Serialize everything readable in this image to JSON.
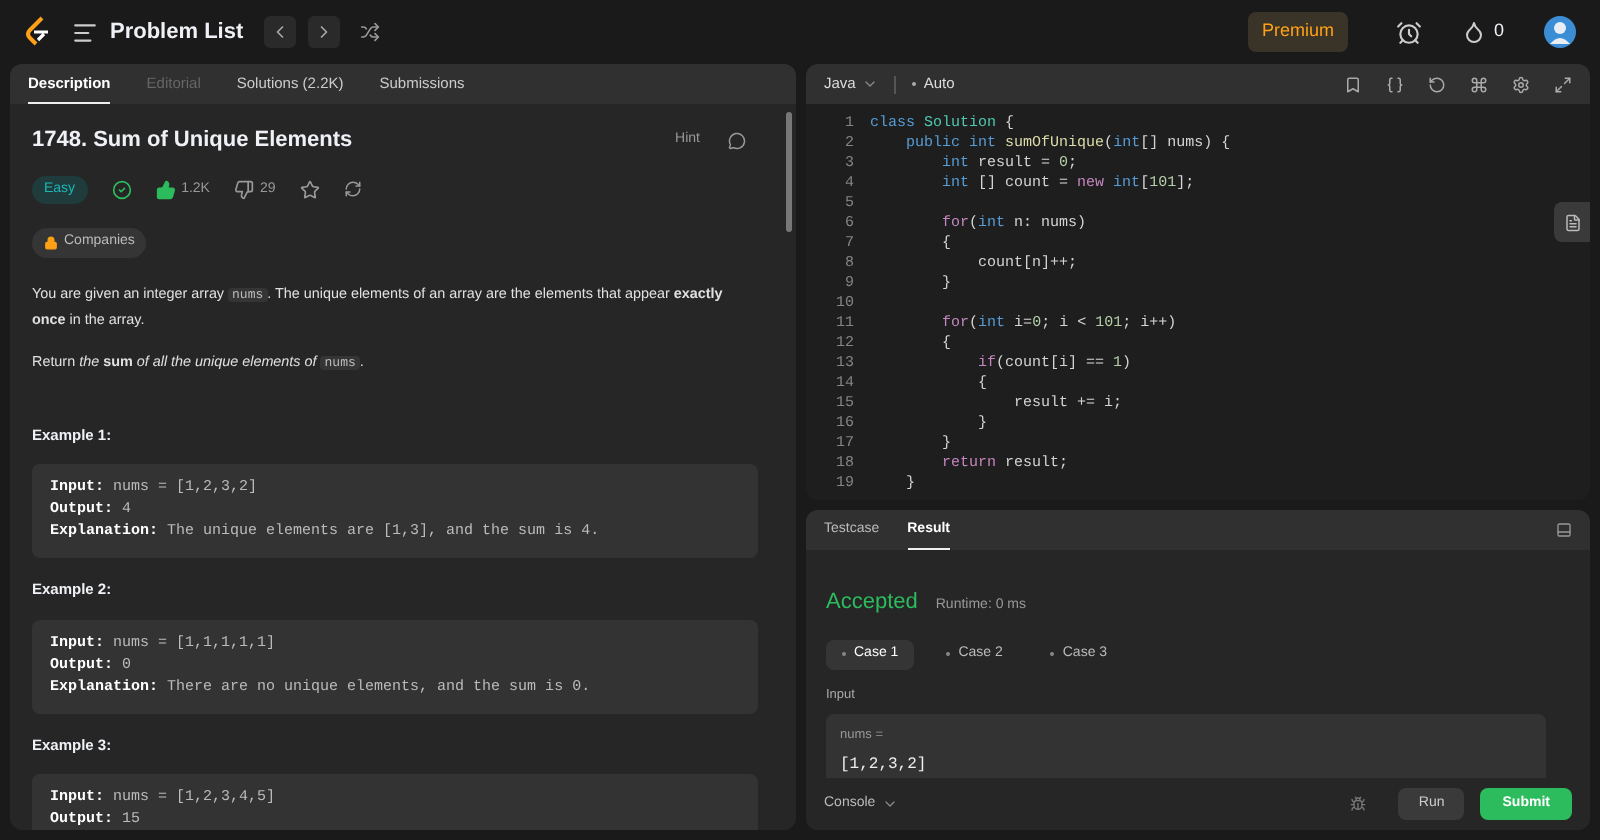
{
  "top_bar": {
    "title": "Problem List",
    "premium": "Premium",
    "streak": "0"
  },
  "left_tabs": [
    {
      "label": "Description",
      "selected": true,
      "disabled": false
    },
    {
      "label": "Editorial",
      "selected": false,
      "disabled": true
    },
    {
      "label": "Solutions (2.2K)",
      "selected": false,
      "disabled": false
    },
    {
      "label": "Submissions",
      "selected": false,
      "disabled": false
    }
  ],
  "problem": {
    "title": "1748. Sum of Unique Elements",
    "hint": "Hint",
    "difficulty": "Easy",
    "solved": true,
    "likes": "1.2K",
    "dislikes": "29",
    "companies": "Companies",
    "paragraphs": [
      [
        {
          "kind": "text",
          "text": "You are given an integer array "
        },
        {
          "kind": "code",
          "text": "nums"
        },
        {
          "kind": "text",
          "text": ". The unique elements of an array are the elements that appear **exactly once** in the array."
        }
      ],
      [
        {
          "kind": "text",
          "text": "Return *the* **sum** *of all the unique elements of* "
        },
        {
          "kind": "code",
          "text": "nums"
        },
        {
          "kind": "text",
          "text": "."
        }
      ]
    ],
    "examples": [
      {
        "title": "Example 1:",
        "lines": [
          {
            "label": "Input:",
            "value": "nums = [1,2,3,2]"
          },
          {
            "label": "Output:",
            "value": "4"
          },
          {
            "label": "Explanation:",
            "value": "The unique elements are [1,3], and the sum is 4."
          }
        ]
      },
      {
        "title": "Example 2:",
        "lines": [
          {
            "label": "Input:",
            "value": "nums = [1,1,1,1,1]"
          },
          {
            "label": "Output:",
            "value": "0"
          },
          {
            "label": "Explanation:",
            "value": "There are no unique elements, and the sum is 0."
          }
        ]
      },
      {
        "title": "Example 3:",
        "lines": [
          {
            "label": "Input:",
            "value": "nums = [1,2,3,4,5]"
          },
          {
            "label": "Output:",
            "value": "15"
          }
        ]
      }
    ]
  },
  "editor": {
    "language": "Java",
    "mode": "Auto",
    "lines": [
      {
        "number": "1",
        "tokens": [
          {
            "kind": "keyword",
            "text": "class"
          },
          {
            "kind": "class",
            "text": " Solution"
          },
          {
            "kind": "plain",
            "text": " {"
          }
        ]
      },
      {
        "number": "2",
        "tokens": [
          {
            "kind": "keyword",
            "text": "    public"
          },
          {
            "kind": "keyword",
            "text": " int"
          },
          {
            "kind": "function",
            "text": " sumOfUnique"
          },
          {
            "kind": "plain",
            "text": "("
          },
          {
            "kind": "keyword",
            "text": "int"
          },
          {
            "kind": "plain",
            "text": "[] nums) {"
          }
        ]
      },
      {
        "number": "3",
        "tokens": [
          {
            "kind": "keyword",
            "text": "        int"
          },
          {
            "kind": "plain",
            "text": " result = "
          },
          {
            "kind": "number",
            "text": "0"
          },
          {
            "kind": "plain",
            "text": ";"
          }
        ]
      },
      {
        "number": "4",
        "tokens": [
          {
            "kind": "keyword",
            "text": "        int"
          },
          {
            "kind": "plain",
            "text": " [] count = "
          },
          {
            "kind": "control",
            "text": "new"
          },
          {
            "kind": "keyword",
            "text": " int"
          },
          {
            "kind": "plain",
            "text": "["
          },
          {
            "kind": "number",
            "text": "101"
          },
          {
            "kind": "plain",
            "text": "];"
          }
        ]
      },
      {
        "number": "5"
      },
      {
        "number": "6",
        "tokens": [
          {
            "kind": "control",
            "text": "        for"
          },
          {
            "kind": "plain",
            "text": "("
          },
          {
            "kind": "keyword",
            "text": "int"
          },
          {
            "kind": "plain",
            "text": " n: nums)"
          }
        ]
      },
      {
        "number": "7",
        "tokens": [
          {
            "kind": "plain",
            "text": "        {"
          }
        ]
      },
      {
        "number": "8",
        "tokens": [
          {
            "kind": "plain",
            "text": "            count[n]++;"
          }
        ]
      },
      {
        "number": "9",
        "tokens": [
          {
            "kind": "plain",
            "text": "        }"
          }
        ]
      },
      {
        "number": "10"
      },
      {
        "number": "11",
        "tokens": [
          {
            "kind": "control",
            "text": "        for"
          },
          {
            "kind": "plain",
            "text": "("
          },
          {
            "kind": "keyword",
            "text": "int"
          },
          {
            "kind": "plain",
            "text": " i="
          },
          {
            "kind": "number",
            "text": "0"
          },
          {
            "kind": "plain",
            "text": "; i < "
          },
          {
            "kind": "number",
            "text": "101"
          },
          {
            "kind": "plain",
            "text": "; i++)"
          }
        ]
      },
      {
        "number": "12",
        "tokens": [
          {
            "kind": "plain",
            "text": "        {"
          }
        ]
      },
      {
        "number": "13",
        "tokens": [
          {
            "kind": "control",
            "text": "            if"
          },
          {
            "kind": "plain",
            "text": "(count[i] == "
          },
          {
            "kind": "number",
            "text": "1"
          },
          {
            "kind": "plain",
            "text": ")"
          }
        ]
      },
      {
        "number": "14",
        "tokens": [
          {
            "kind": "plain",
            "text": "            {"
          }
        ]
      },
      {
        "number": "15",
        "tokens": [
          {
            "kind": "plain",
            "text": "                result += i;"
          }
        ]
      },
      {
        "number": "16",
        "tokens": [
          {
            "kind": "plain",
            "text": "            }"
          }
        ]
      },
      {
        "number": "17",
        "tokens": [
          {
            "kind": "plain",
            "text": "        }"
          }
        ]
      },
      {
        "number": "18",
        "tokens": [
          {
            "kind": "control",
            "text": "        return"
          },
          {
            "kind": "plain",
            "text": " result;"
          }
        ]
      },
      {
        "number": "19",
        "tokens": [
          {
            "kind": "plain",
            "text": "    }"
          }
        ]
      }
    ]
  },
  "result_tabs": [
    {
      "label": "Testcase",
      "selected": false
    },
    {
      "label": "Result",
      "selected": true
    }
  ],
  "result": {
    "status": "Accepted",
    "runtime": "Runtime: 0 ms",
    "cases": [
      {
        "label": "Case 1",
        "selected": true
      },
      {
        "label": "Case 2",
        "selected": false
      },
      {
        "label": "Case 3",
        "selected": false
      }
    ],
    "input_label": "Input",
    "param": "nums =",
    "value": "[1,2,3,2]"
  },
  "bottom_bar": {
    "console": "Console",
    "run": "Run",
    "submit": "Submit"
  }
}
